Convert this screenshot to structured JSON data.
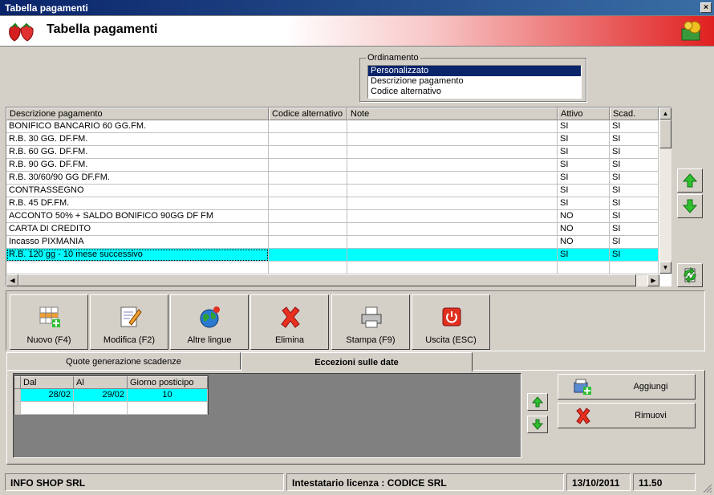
{
  "window": {
    "title": "Tabella pagamenti"
  },
  "header": {
    "title": "Tabella pagamenti"
  },
  "ordinamento": {
    "label": "Ordinamento",
    "options": [
      "Personalizzato",
      "Descrizione pagamento",
      "Codice alternativo"
    ],
    "selected": "Personalizzato"
  },
  "grid": {
    "columns": [
      "Descrizione pagamento",
      "Codice alternativo",
      "Note",
      "Attivo",
      "Scad."
    ],
    "rows": [
      [
        "BONIFICO BANCARIO 60 GG.FM.",
        "",
        "",
        "SI",
        "SI"
      ],
      [
        "R.B. 30 GG. DF.FM.",
        "",
        "",
        "SI",
        "SI"
      ],
      [
        "R.B. 60 GG. DF.FM.",
        "",
        "",
        "SI",
        "SI"
      ],
      [
        "R.B. 90 GG. DF.FM.",
        "",
        "",
        "SI",
        "SI"
      ],
      [
        "R.B. 30/60/90 GG DF.FM.",
        "",
        "",
        "SI",
        "SI"
      ],
      [
        "CONTRASSEGNO",
        "",
        "",
        "SI",
        "SI"
      ],
      [
        "R.B. 45 DF.FM.",
        "",
        "",
        "SI",
        "SI"
      ],
      [
        "ACCONTO 50% + SALDO BONIFICO 90GG DF FM",
        "",
        "",
        "NO",
        "SI"
      ],
      [
        "CARTA DI CREDITO",
        "",
        "",
        "NO",
        "SI"
      ],
      [
        "Incasso PIXMANIA",
        "",
        "",
        "NO",
        "SI"
      ],
      [
        "R.B. 120 gg - 10 mese successivo",
        "",
        "",
        "SI",
        "SI"
      ],
      [
        "",
        "",
        "",
        "",
        ""
      ]
    ],
    "selected_row": 10
  },
  "toolbar": {
    "nuovo": "Nuovo (F4)",
    "modifica": "Modifica (F2)",
    "lingue": "Altre lingue",
    "elimina": "Elimina",
    "stampa": "Stampa (F9)",
    "uscita": "Uscita (ESC)"
  },
  "tabs": {
    "tab1": "Quote generazione scadenze",
    "tab2": "Eccezioni sulle date"
  },
  "eccezioni": {
    "columns": [
      "Dal",
      "Al",
      "Giorno posticipo"
    ],
    "rows": [
      [
        "28/02",
        "29/02",
        "10"
      ],
      [
        "",
        "",
        ""
      ]
    ]
  },
  "actions": {
    "aggiungi": "Aggiungi",
    "rimuovi": "Rimuovi"
  },
  "status": {
    "company": "INFO SHOP SRL",
    "license": "Intestatario licenza : CODICE SRL",
    "date": "13/10/2011",
    "time": "11.50"
  },
  "colors": {
    "selection": "#00ffff",
    "titlebar": "#0a246a",
    "face": "#d4d0c8"
  }
}
